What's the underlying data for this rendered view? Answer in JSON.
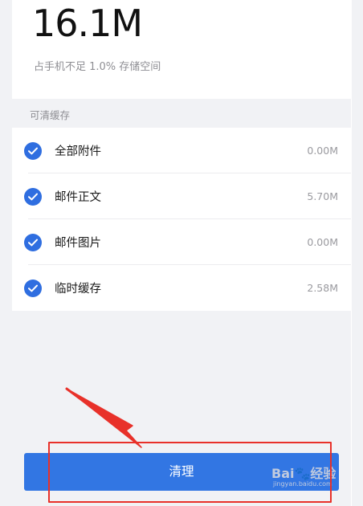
{
  "storage": {
    "size": "16.1M",
    "note": "占手机不足 1.0% 存储空间"
  },
  "cache": {
    "header": "可清缓存",
    "items": [
      {
        "label": "全部附件",
        "size": "0.00M",
        "checked": true
      },
      {
        "label": "邮件正文",
        "size": "5.70M",
        "checked": true
      },
      {
        "label": "邮件图片",
        "size": "0.00M",
        "checked": true
      },
      {
        "label": "临时缓存",
        "size": "2.58M",
        "checked": true
      }
    ]
  },
  "actions": {
    "clean_label": "清理"
  },
  "annotation": {
    "highlight_color": "#e8312a"
  },
  "watermark": {
    "brand": "Bai",
    "brand_suffix": "经验",
    "site": "jingyan.baidu.com"
  },
  "colors": {
    "accent": "#3276e3",
    "check": "#2f6ee0",
    "background": "#f1f2f5"
  }
}
